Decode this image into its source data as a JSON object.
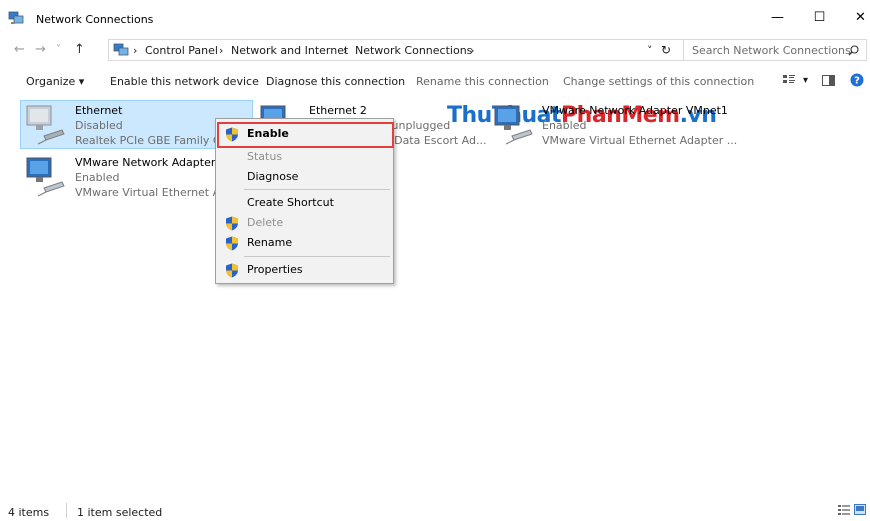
{
  "window": {
    "title": "Network Connections",
    "min_glyph": "—",
    "max_glyph": "☐",
    "close_glyph": "✕"
  },
  "nav": {
    "back_glyph": "←",
    "forward_glyph": "→",
    "recent_glyph": "˅",
    "up_glyph": "↑"
  },
  "address": {
    "sep_glyph": "›",
    "crumbs": [
      "Control Panel",
      "Network and Internet",
      "Network Connections"
    ],
    "dropdown_glyph": "˅",
    "refresh_glyph": "↻"
  },
  "search": {
    "placeholder": "Search Network Connections"
  },
  "commands": {
    "organize": "Organize ▾",
    "enable_device": "Enable this network device",
    "diagnose": "Diagnose this connection",
    "rename": "Rename this connection",
    "change_settings": "Change settings of this connection",
    "view_dropdown_glyph": "▾"
  },
  "watermark": {
    "part1": "ThuThuat",
    "part2": "PhanMem",
    "part3": ".vn"
  },
  "items": [
    {
      "name": "Ethernet",
      "status": "Disabled",
      "device": "Realtek PCIe GBE Family Controller"
    },
    {
      "name": "Ethernet 2",
      "status": "Network cable unplugged",
      "device": "TAP-ProtonVPN Data Escort Ad..."
    },
    {
      "name": "VMware Network Adapter VMnet1",
      "status": "Enabled",
      "device": "VMware Virtual Ethernet Adapter ..."
    },
    {
      "name": "VMware Network Adapter VMnet8",
      "status": "Enabled",
      "device": "VMware Virtual Ethernet Adapter ..."
    }
  ],
  "context_menu": {
    "enable": "Enable",
    "status": "Status",
    "diagnose": "Diagnose",
    "create_shortcut": "Create Shortcut",
    "delete": "Delete",
    "rename": "Rename",
    "properties": "Properties"
  },
  "statusbar": {
    "count": "4 items",
    "selected": "1 item selected"
  },
  "colors": {
    "selection_bg": "#cce8ff",
    "highlight_border": "#e43f3f",
    "watermark_blue": "#1a6fc9",
    "watermark_red": "#d9262b"
  }
}
